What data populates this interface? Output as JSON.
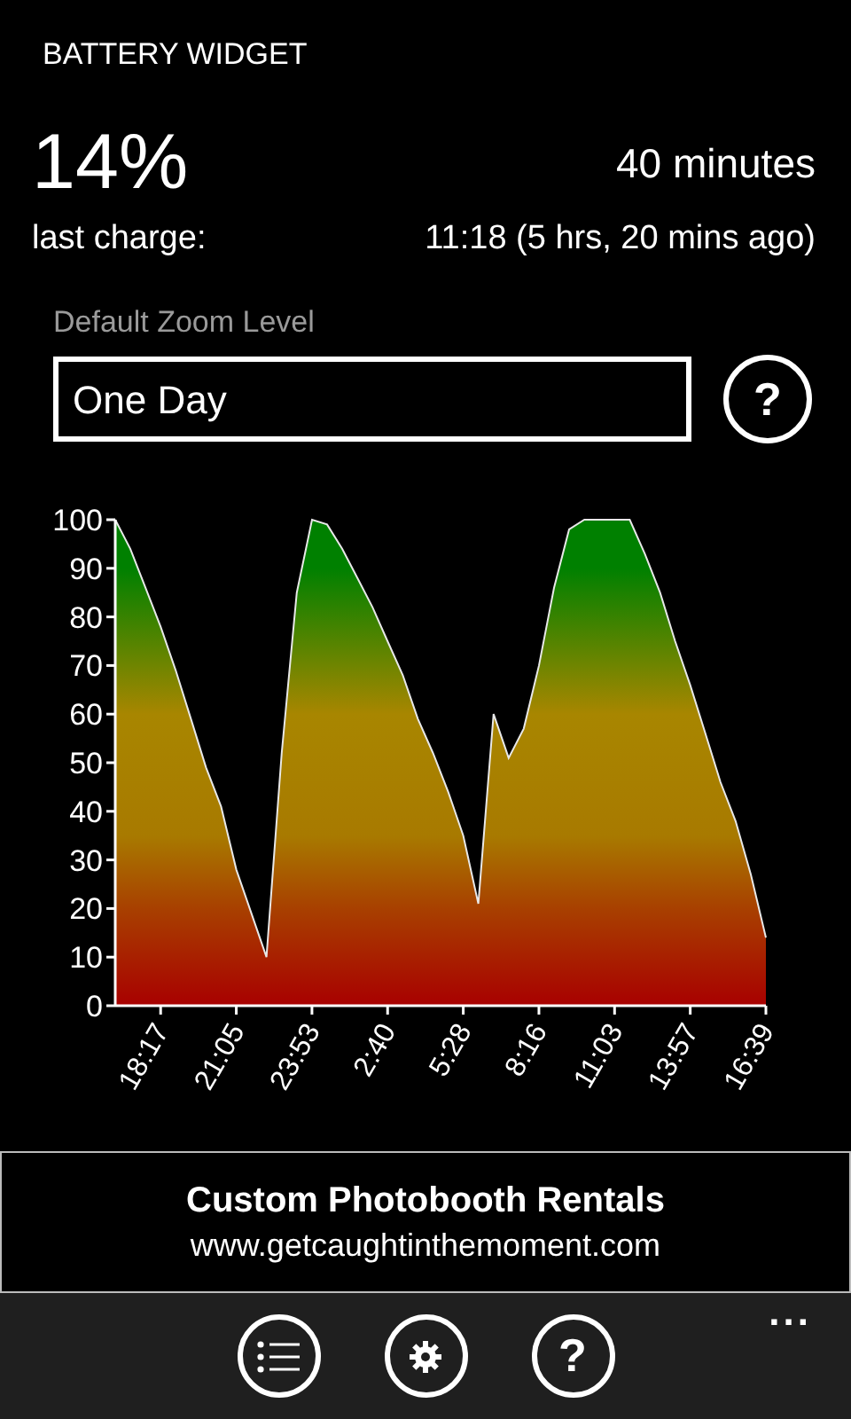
{
  "app_title": "BATTERY WIDGET",
  "status": {
    "level_text": "14%",
    "remaining": "40 minutes",
    "last_charge_label": "last charge:",
    "last_charge_value": "11:18 (5 hrs, 20 mins ago)"
  },
  "zoom": {
    "label": "Default Zoom Level",
    "value": "One Day",
    "help": "?"
  },
  "chart_data": {
    "type": "area",
    "ylim": [
      0,
      100
    ],
    "yticks": [
      0,
      10,
      20,
      30,
      40,
      50,
      60,
      70,
      80,
      90,
      100
    ],
    "categories": [
      null,
      null,
      null,
      "18:17",
      null,
      null,
      null,
      null,
      "21:05",
      null,
      null,
      null,
      null,
      "23:53",
      null,
      null,
      null,
      null,
      "2:40",
      null,
      null,
      null,
      null,
      "5:28",
      null,
      null,
      null,
      null,
      "8:16",
      null,
      null,
      null,
      null,
      "11:03",
      null,
      null,
      null,
      null,
      "13:57",
      null,
      null,
      null,
      null,
      "16:39"
    ],
    "series": [
      {
        "values": [
          100,
          94,
          86,
          78,
          69,
          59,
          49,
          41,
          28,
          19,
          10,
          52,
          85,
          100,
          99,
          94,
          88,
          82,
          75,
          68,
          59,
          52,
          44,
          35,
          21,
          60,
          51,
          57,
          70,
          86,
          98,
          100,
          100,
          100,
          100,
          93,
          85,
          75,
          66,
          56,
          46,
          38,
          27,
          14
        ]
      }
    ]
  },
  "ad": {
    "title": "Custom Photobooth Rentals",
    "url": "www.getcaughtinthemoment.com"
  },
  "app_bar": {
    "help": "?",
    "more": "..."
  }
}
